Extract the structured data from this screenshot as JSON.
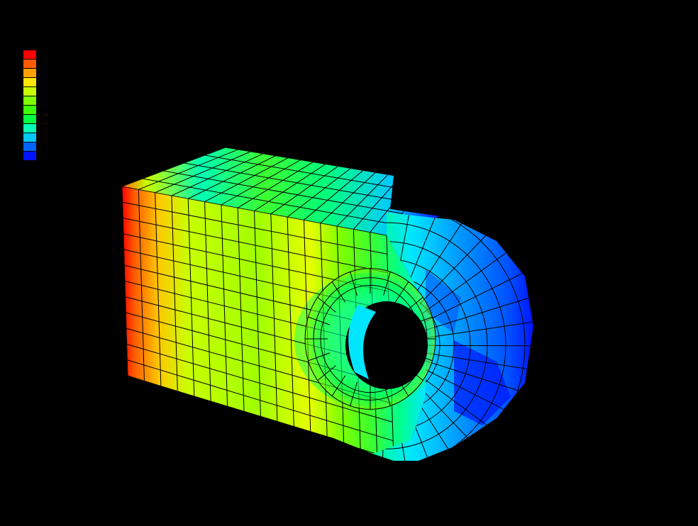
{
  "view": {
    "background": "#000000",
    "description_visible_text": ""
  },
  "legend": {
    "colors": [
      "#ff0000",
      "#ff5a00",
      "#ffa000",
      "#ffe600",
      "#c8ff00",
      "#80ff00",
      "#3cff00",
      "#00ff40",
      "#00ffb4",
      "#00c8ff",
      "#0064ff",
      "#0014ff"
    ]
  },
  "model": {
    "contour_palette": {
      "max": "#ff0000",
      "high": "#ffa000",
      "upper_mid": "#e6ff00",
      "mid": "#78ff00",
      "lower_mid": "#00ff60",
      "low": "#00e6ff",
      "lower": "#0078ff",
      "min": "#0014ff"
    },
    "mesh_line_color": "#000000"
  }
}
